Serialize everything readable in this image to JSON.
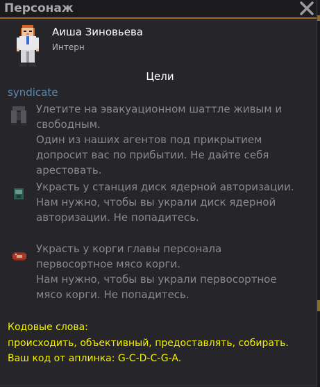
{
  "window": {
    "title": "Персонаж"
  },
  "character": {
    "name": "Аиша Зиновьева",
    "job": "Интерн"
  },
  "goals": {
    "title": "Цели",
    "faction": "syndicate",
    "objectives": [
      {
        "icon": "jetpack-icon",
        "task": "Улетите на эвакуационном шаттле живым и свободным.",
        "hint": "Один из наших агентов под прикрытием допросит вас по прибытии. Не дайте себя арестовать."
      },
      {
        "icon": "disk-icon",
        "task": "Украсть у станция диск ядерной авторизации.",
        "hint": "Нам нужно, чтобы вы украли диск ядерной авторизации. Не попадитесь."
      },
      {
        "icon": "meat-icon",
        "task": "Украсть у корги главы персонала первосортное мясо корги.",
        "hint": "Нам нужно, чтобы вы украли первосортное мясо корги. Не попадитесь."
      }
    ]
  },
  "codewords": {
    "label": "Кодовые слова:",
    "words": "происходить, объективный, предоставлять, собирать.",
    "uplink": "Ваш код от аплинка: G-C-D-C-G-A."
  }
}
